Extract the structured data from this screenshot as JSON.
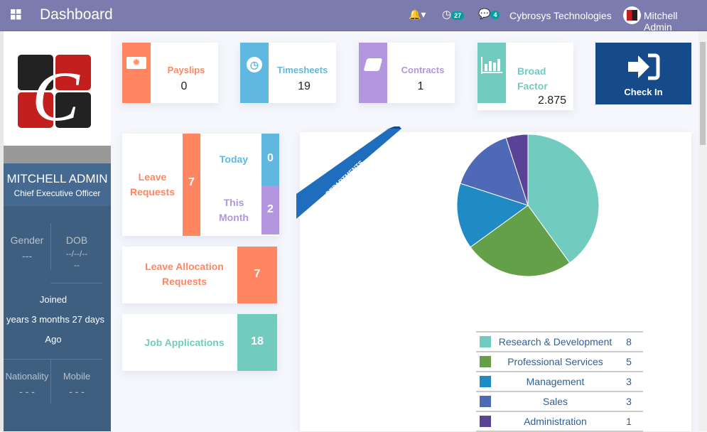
{
  "header": {
    "title": "Dashboard",
    "activity_count": "27",
    "message_count": "4",
    "company": "Cybrosys Technologies",
    "user": "Mitchell Admin"
  },
  "profile": {
    "name": "MITCHELL ADMIN",
    "job_title": "Chief Executive Officer",
    "gender_label": "Gender",
    "gender": "---",
    "dob_label": "DOB",
    "dob": "--/--/--",
    "dob_extra": "--",
    "joined_label": "Joined",
    "joined": "years 3 months 27 days",
    "joined_suffix": "Ago",
    "nationality_label": "Nationality",
    "nationality": "- - -",
    "mobile_label": "Mobile",
    "mobile": "- - -"
  },
  "tiles": [
    {
      "label": "Payslips",
      "value": "0",
      "color": "#ff8660",
      "icon": "money-icon"
    },
    {
      "label": "Timesheets",
      "value": "19",
      "color": "#5fb8df",
      "icon": "clock-icon"
    },
    {
      "label": "Contracts",
      "value": "1",
      "color": "#b296e0",
      "icon": "book-icon"
    },
    {
      "label": "Broad Factor",
      "value": "2.875",
      "color": "#72cbbf",
      "icon": "bar-chart-icon"
    }
  ],
  "check_in": {
    "label": "Check In",
    "color": "#154b8a"
  },
  "leave": {
    "label": "Leave Requests",
    "value": "7",
    "today_label": "Today",
    "today": "0",
    "month_label": "This Month",
    "month": "2"
  },
  "allocation": {
    "label": "Leave Allocation Requests",
    "value": "7"
  },
  "jobs": {
    "label": "Job Applications",
    "value": "18"
  },
  "chart_data": {
    "type": "pie",
    "ribbon": "DEPARTMENTS",
    "categories": [
      "Research & Development",
      "Professional Services",
      "Management",
      "Sales",
      "Administration"
    ],
    "values": [
      8,
      5,
      3,
      3,
      1
    ],
    "colors": [
      "#72cbbf",
      "#64a04a",
      "#1f8ac3",
      "#4e6ab7",
      "#5a4396"
    ]
  }
}
